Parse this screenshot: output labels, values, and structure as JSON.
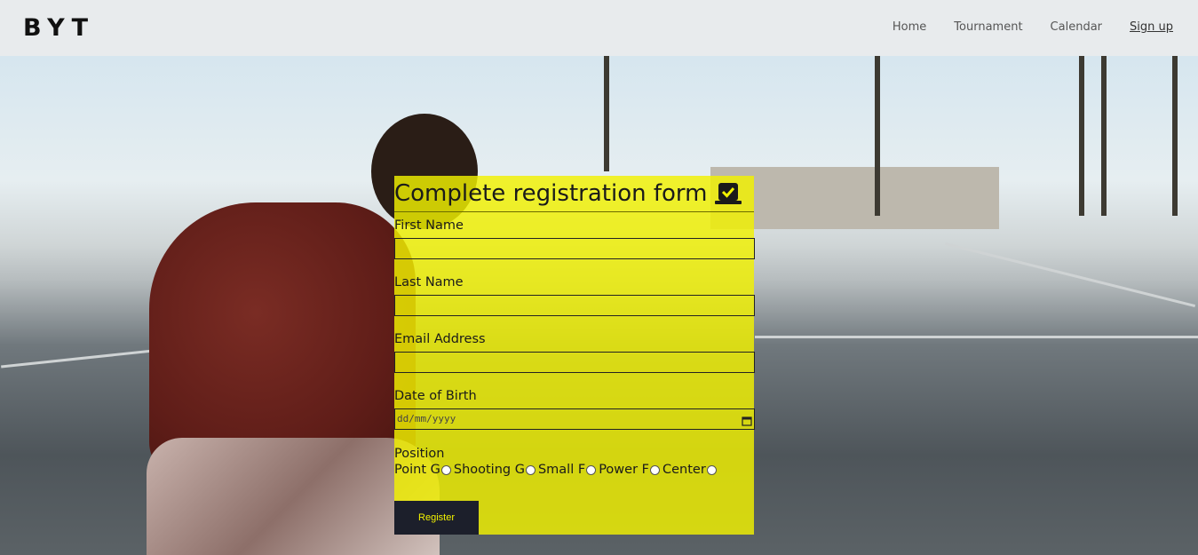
{
  "header": {
    "logo": "BYT",
    "nav": [
      {
        "label": "Home"
      },
      {
        "label": "Tournament"
      },
      {
        "label": "Calendar"
      },
      {
        "label": "Sign up"
      }
    ]
  },
  "form": {
    "title": "Complete registration form",
    "title_icon": "check-square-icon",
    "fields": [
      {
        "label": "First Name",
        "value": ""
      },
      {
        "label": "Last Name",
        "value": ""
      },
      {
        "label": "Email Address",
        "value": ""
      },
      {
        "label": "Date of Birth",
        "value": "dd/mm/yyyy"
      }
    ],
    "position": {
      "label": "Position",
      "options": [
        "Point G",
        "Shooting G",
        "Small F",
        "Power F",
        "Center"
      ]
    },
    "submit_label": "Register"
  },
  "colors": {
    "form_bg": "#f2f200",
    "button_bg": "#1c1f2b",
    "button_text": "#f2f200"
  }
}
